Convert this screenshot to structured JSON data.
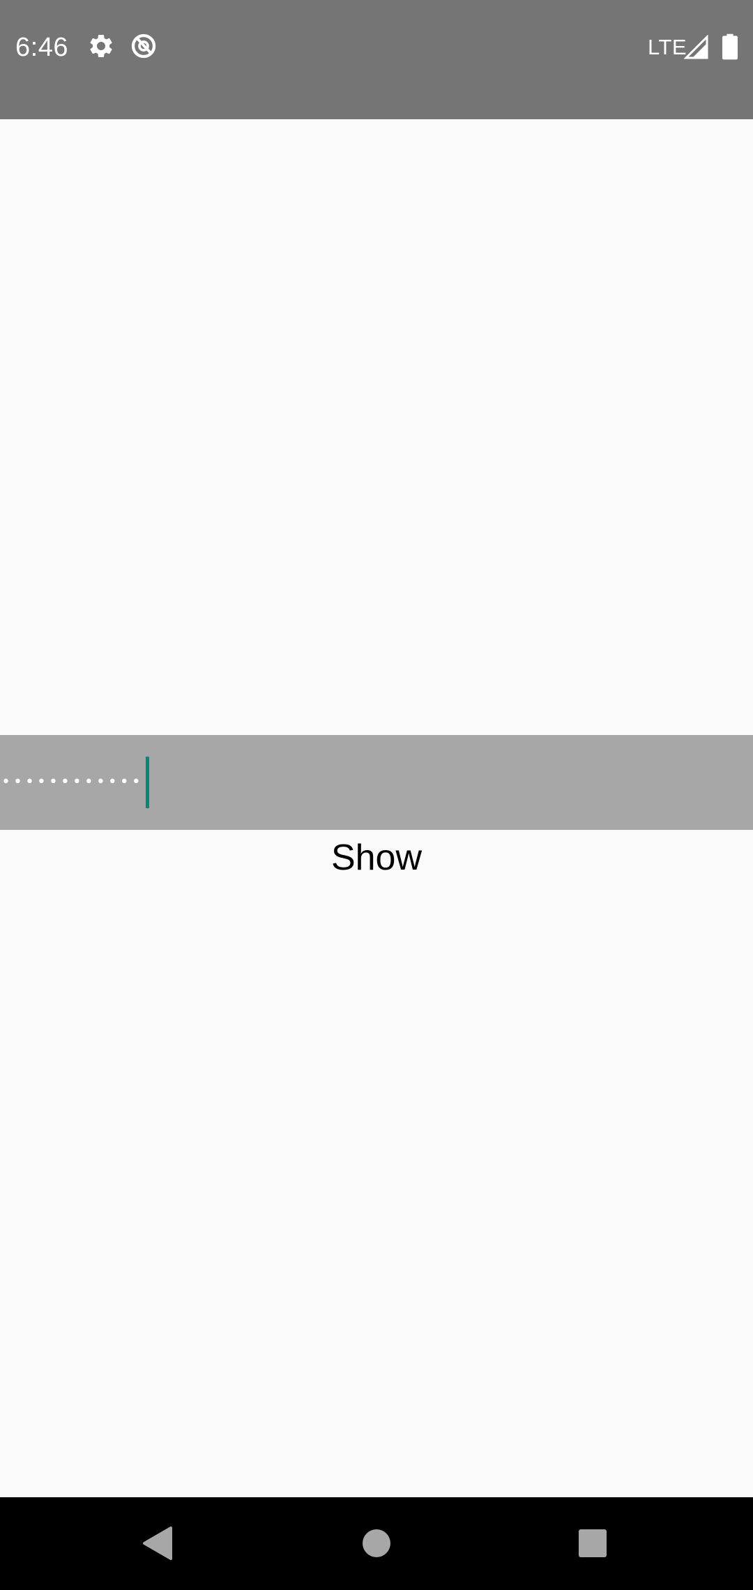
{
  "status_bar": {
    "time": "6:46",
    "network": "LTE",
    "icons": [
      "gear-icon",
      "data-saver-icon",
      "signal-icon",
      "battery-icon"
    ],
    "background": "#757575"
  },
  "password_field": {
    "masked_value": "••••••••••••",
    "background": "#A7A7A8",
    "cursor_color": "#00897B"
  },
  "show_button": {
    "label": "Show"
  },
  "navigation_bar": {
    "buttons": [
      "back-icon",
      "home-icon",
      "recents-icon"
    ],
    "background": "#000000"
  }
}
